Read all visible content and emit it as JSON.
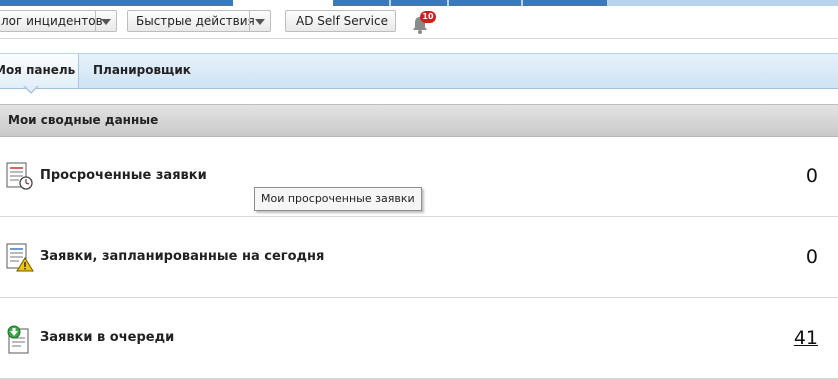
{
  "toolbar": {
    "incident_catalog_label": "лог инцидентов",
    "quick_actions_label": "Быстрые действия",
    "ad_self_service_label": "AD Self Service",
    "notifications_count": "10"
  },
  "tabs": [
    {
      "label": "Моя панель",
      "active": true
    },
    {
      "label": "Планировщик",
      "active": false
    }
  ],
  "section": {
    "title": "Мои сводные данные"
  },
  "rows": [
    {
      "label": "Просроченные заявки",
      "count": "0",
      "icon": "overdue-requests-icon"
    },
    {
      "label": "Заявки, запланированные на сегодня",
      "count": "0",
      "icon": "requests-due-today-icon"
    },
    {
      "label": "Заявки в очереди",
      "count": "41",
      "icon": "requests-in-queue-icon"
    }
  ],
  "tooltip": {
    "text": "Мои просроченные заявки"
  },
  "colors": {
    "tab_bar": "#cfe3f3",
    "strip_blue": "#3c78b4",
    "badge_red": "#d11f1f",
    "section_gray": "#d6d6d6"
  }
}
